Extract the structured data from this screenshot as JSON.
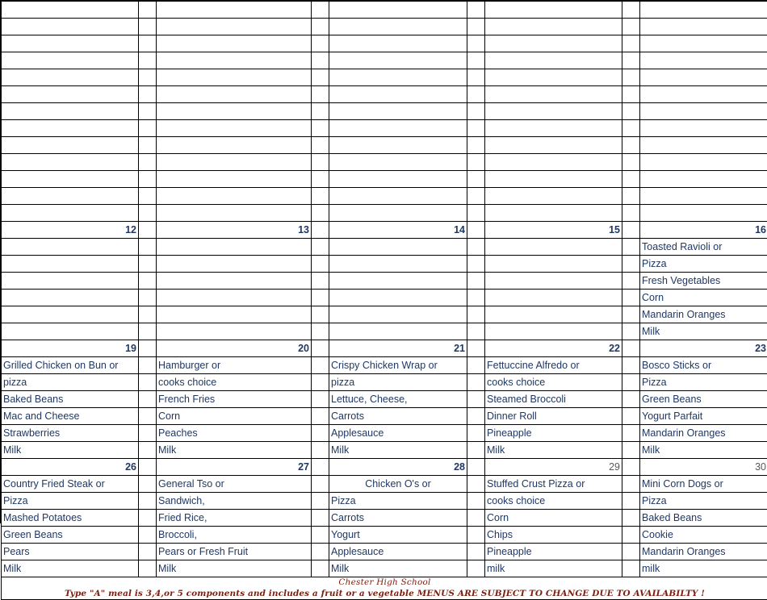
{
  "document": {
    "kind": "spreadsheet-lunch-menu-calendar",
    "school_name": "Chester High School",
    "disclaimer": "Type \"A\" meal is 3,4,or 5 components and includes a fruit or a vegetable MENUS ARE SUBJECT TO CHANGE DUE TO AVAILABILTY !"
  },
  "colors": {
    "accent": "#FF9900",
    "shaded": "#666666",
    "text": "#1f3864",
    "footer_text": "#7b1f10",
    "grid": "#000000"
  },
  "layout": {
    "columns": 5,
    "blank_rows_per_week": 6
  },
  "weeks": [
    {
      "id": "week-blank-1",
      "shaded": true,
      "header_shown": false,
      "days": [
        {
          "num": "",
          "shaded": true,
          "items": [
            "",
            "",
            "",
            "",
            ""
          ]
        },
        {
          "num": "",
          "shaded": true,
          "items": [
            "",
            "",
            "",
            "",
            ""
          ]
        },
        {
          "num": "",
          "shaded": true,
          "items": [
            "",
            "",
            "",
            "",
            ""
          ]
        },
        {
          "num": "",
          "shaded": true,
          "items": [
            "",
            "",
            "",
            "",
            ""
          ]
        },
        {
          "num": "",
          "shaded": true,
          "items": [
            "",
            "",
            "",
            "",
            ""
          ]
        }
      ]
    },
    {
      "id": "week-blank-2",
      "shaded": true,
      "header_shown": false,
      "days": [
        {
          "num": "",
          "shaded": true,
          "items": [
            "",
            "",
            "",
            "",
            "",
            ""
          ]
        },
        {
          "num": "",
          "shaded": true,
          "items": [
            "",
            "",
            "",
            "",
            "",
            ""
          ]
        },
        {
          "num": "",
          "shaded": true,
          "items": [
            "",
            "",
            "",
            "",
            "",
            ""
          ]
        },
        {
          "num": "",
          "shaded": false,
          "items": [
            "",
            "",
            "",
            "",
            "",
            ""
          ]
        },
        {
          "num": "",
          "shaded": false,
          "items": [
            "",
            "",
            "",
            "",
            "",
            ""
          ]
        }
      ]
    },
    {
      "id": "week-12-16",
      "shaded": false,
      "header_shown": true,
      "days": [
        {
          "num": "12",
          "faint": false,
          "items": [
            "",
            "",
            "",
            "",
            "",
            ""
          ]
        },
        {
          "num": "13",
          "faint": false,
          "items": [
            "",
            "",
            "",
            "",
            "",
            ""
          ]
        },
        {
          "num": "14",
          "faint": false,
          "items": [
            "",
            "",
            "",
            "",
            "",
            ""
          ]
        },
        {
          "num": "15",
          "faint": false,
          "items": [
            "",
            "",
            "",
            "",
            "",
            ""
          ]
        },
        {
          "num": "16",
          "faint": false,
          "items": [
            "Toasted Ravioli or",
            "Pizza",
            "Fresh Vegetables",
            "Corn",
            "Mandarin Oranges",
            "Milk"
          ]
        }
      ]
    },
    {
      "id": "week-19-23",
      "shaded": false,
      "header_shown": true,
      "days": [
        {
          "num": "19",
          "faint": false,
          "items": [
            "Grilled Chicken on Bun or",
            "pizza",
            "Baked Beans",
            "Mac and Cheese",
            "Strawberries",
            "Milk"
          ]
        },
        {
          "num": "20",
          "faint": false,
          "items": [
            "Hamburger or",
            "cooks choice",
            "French Fries",
            "Corn",
            "Peaches",
            "Milk"
          ]
        },
        {
          "num": "21",
          "faint": false,
          "items": [
            "Crispy Chicken Wrap or",
            "pizza",
            "Lettuce, Cheese,",
            "Carrots",
            "Applesauce",
            "Milk"
          ]
        },
        {
          "num": "22",
          "faint": false,
          "items": [
            "Fettuccine Alfredo or",
            "cooks choice",
            "Steamed Broccoli",
            "Dinner Roll",
            "Pineapple",
            "Milk"
          ]
        },
        {
          "num": "23",
          "faint": false,
          "items": [
            "Bosco Sticks or",
            "Pizza",
            "Green Beans",
            "Yogurt Parfait",
            "Mandarin Oranges",
            "Milk"
          ]
        }
      ]
    },
    {
      "id": "week-26-30",
      "shaded": false,
      "header_shown": true,
      "days": [
        {
          "num": "26",
          "faint": false,
          "items": [
            "Country Fried Steak or",
            "Pizza",
            "Mashed Potatoes",
            "Green Beans",
            "Pears",
            "Milk"
          ]
        },
        {
          "num": "27",
          "faint": false,
          "items": [
            "General Tso or",
            "Sandwich,",
            "Fried Rice,",
            "Broccoli,",
            "Pears or Fresh Fruit",
            "Milk"
          ]
        },
        {
          "num": "28",
          "faint": false,
          "center_first": true,
          "items": [
            "Chicken O's or",
            "Pizza",
            "Carrots",
            "Yogurt",
            "Applesauce",
            "Milk"
          ]
        },
        {
          "num": "29",
          "faint": true,
          "items": [
            "Stuffed Crust Pizza or",
            "cooks choice",
            "Corn",
            "Chips",
            "Pineapple",
            "milk"
          ]
        },
        {
          "num": "30",
          "faint": true,
          "items": [
            "Mini Corn Dogs or",
            "Pizza",
            "Baked Beans",
            "Cookie",
            "Mandarin Oranges",
            "milk"
          ]
        }
      ]
    }
  ]
}
